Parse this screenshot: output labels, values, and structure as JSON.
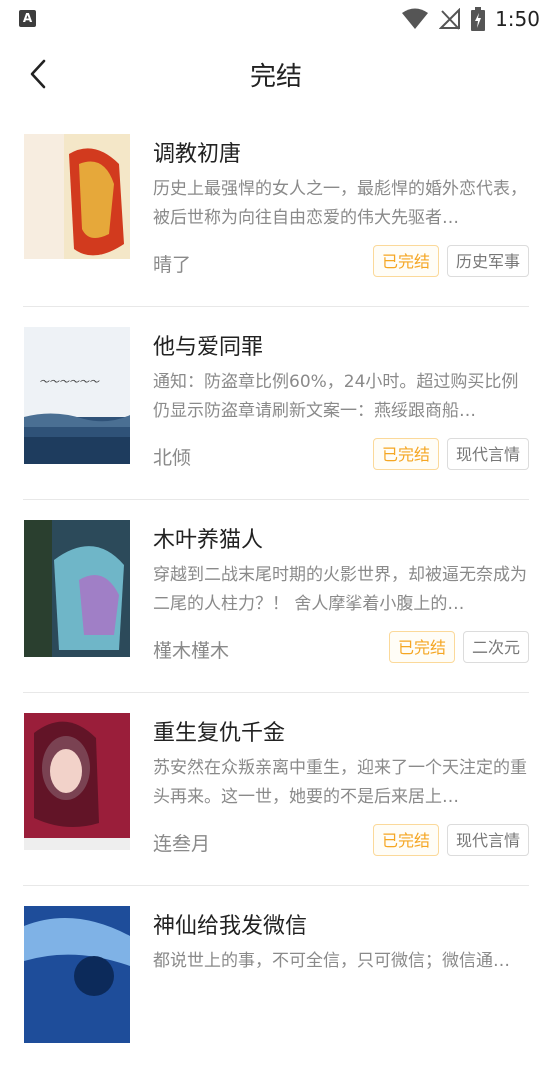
{
  "status_bar": {
    "time": "1:50",
    "app_icon_letter": "A"
  },
  "header": {
    "title": "完结",
    "back_icon": "chevron-left-icon"
  },
  "books": [
    {
      "title": "调教初唐",
      "description": "历史上最强悍的女人之一，最彪悍的婚外恋代表，被后世称为向往自由恋爱的伟大先驱者…",
      "author": "晴了",
      "status": "已完结",
      "category": "历史军事",
      "cover_colors": [
        "#f4e7c8",
        "#d23a1e",
        "#e6a83a"
      ]
    },
    {
      "title": "他与爱同罪",
      "description": "通知：防盗章比例60%，24小时。超过购买比例仍显示防盗章请刷新文案一：燕绥跟商船…",
      "author": "北倾",
      "status": "已完结",
      "category": "现代言情",
      "cover_colors": [
        "#eef2f6",
        "#1e3c5e",
        "#4a6f93"
      ]
    },
    {
      "title": "木叶养猫人",
      "description": "穿越到二战末尾时期的火影世界，却被逼无奈成为二尾的人柱力？！ 舍人摩挲着小腹上的…",
      "author": "槿木槿木",
      "status": "已完结",
      "category": "二次元",
      "cover_colors": [
        "#2c4a5a",
        "#6fb6c8",
        "#a07fc6"
      ]
    },
    {
      "title": "重生复仇千金",
      "description": "苏安然在众叛亲离中重生，迎来了一个天注定的重头再来。这一世，她要的不是后来居上…",
      "author": "连叁月",
      "status": "已完结",
      "category": "现代言情",
      "cover_colors": [
        "#9a1e3a",
        "#e9b8c9",
        "#4a1020"
      ]
    },
    {
      "title": "神仙给我发微信",
      "description": "都说世上的事，不可全信，只可微信；微信通…",
      "author": "",
      "status": "",
      "category": "",
      "cover_colors": [
        "#1e4d9a",
        "#7fb2e6",
        "#0c2a5a"
      ]
    }
  ]
}
